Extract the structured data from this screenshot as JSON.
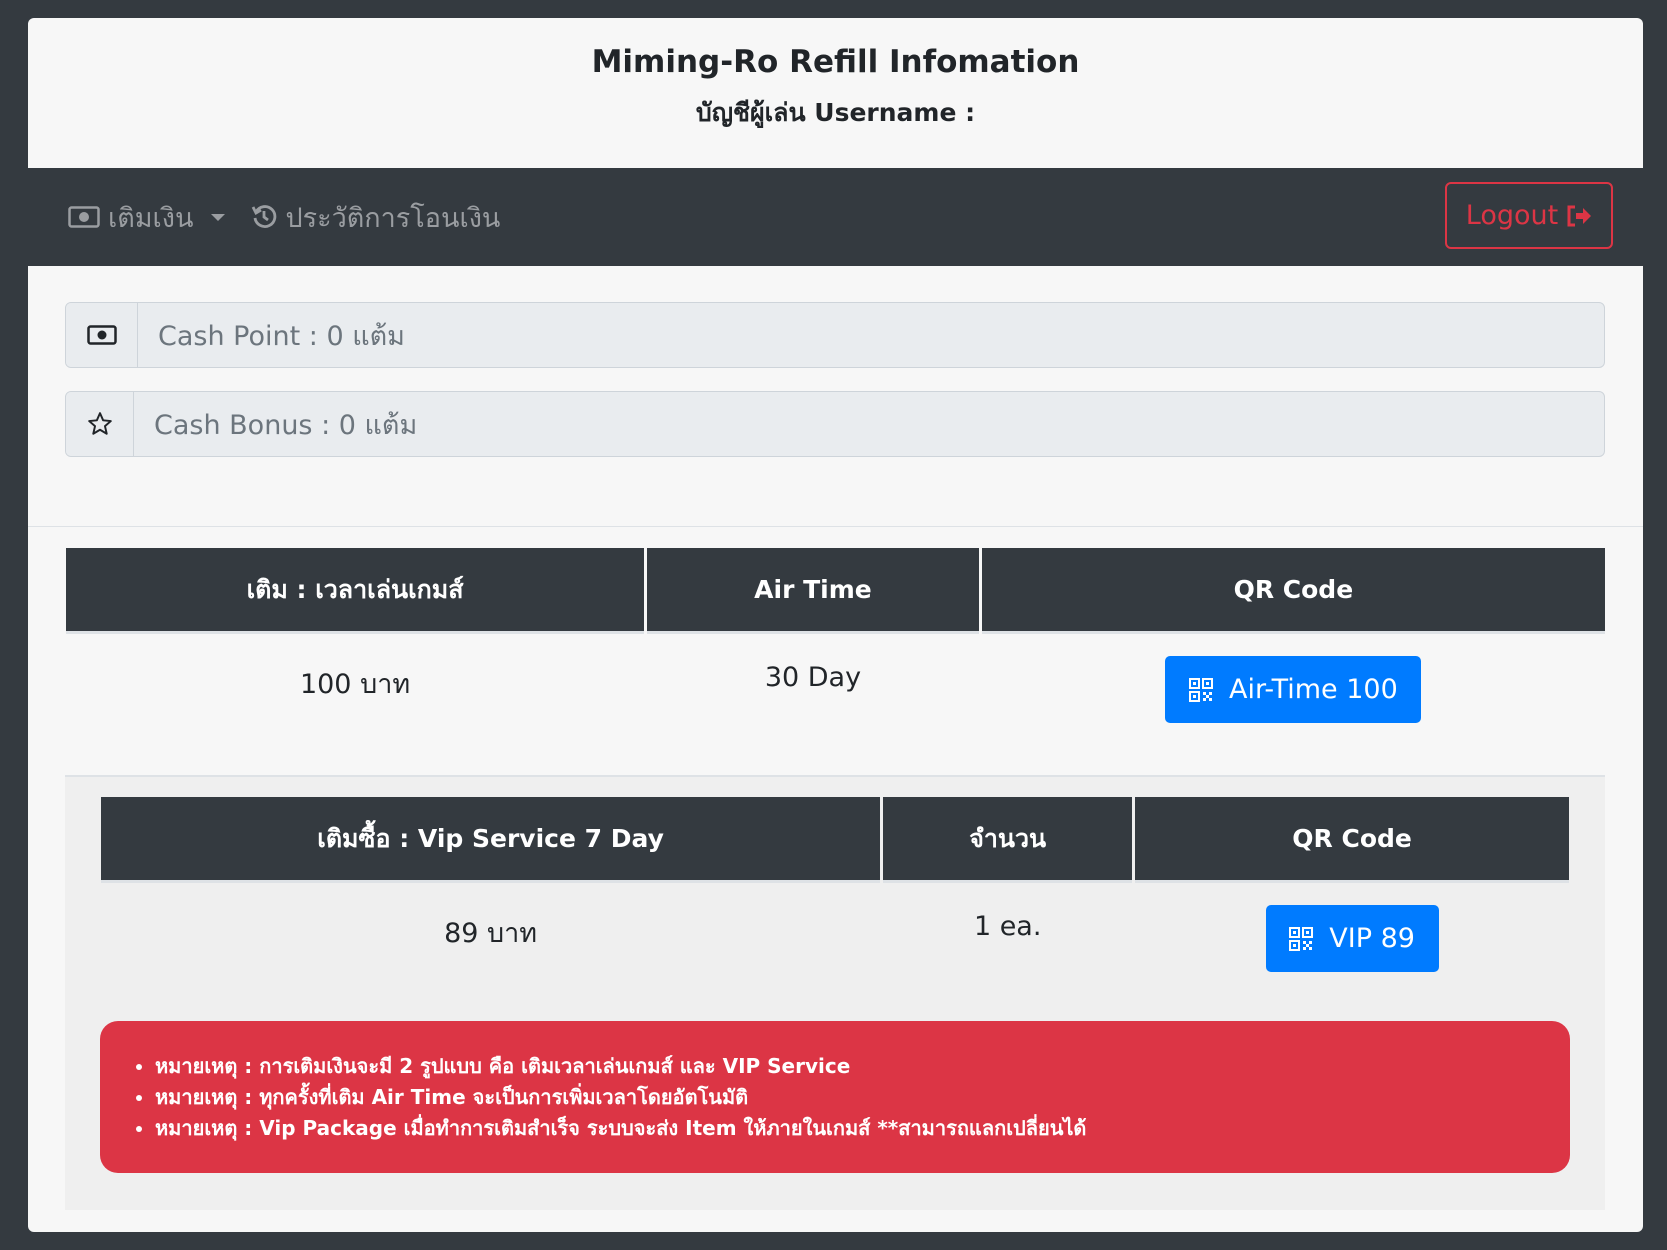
{
  "header": {
    "title": "Miming-Ro Refill Infomation",
    "subtitle": "บัญชีผู้เล่น Username :"
  },
  "navbar": {
    "topup_label": "เติมเงิน",
    "history_label": "ประวัติการโอนเงิน",
    "logout_label": "Logout"
  },
  "balances": {
    "cash_point": "Cash Point : 0 แต้ม",
    "cash_bonus": "Cash Bonus : 0 แต้ม"
  },
  "airtime_table": {
    "headers": [
      "เติม : เวลาเล่นเกมส์",
      "Air Time",
      "QR Code"
    ],
    "row": {
      "price": "100 บาท",
      "duration": "30 Day",
      "button": "Air-Time 100"
    }
  },
  "vip_table": {
    "headers": [
      "เติมซื้อ : Vip Service 7 Day",
      "จำนวน",
      "QR Code"
    ],
    "row": {
      "price": "89 บาท",
      "quantity": "1 ea.",
      "button": "VIP 89"
    }
  },
  "notes": [
    "หมายเหตุ : การเติมเงินจะมี 2 รูปแบบ คือ เติมเวลาเล่นเกมส์ และ VIP Service",
    "หมายเหตุ : ทุกครั้งที่เติม Air Time จะเป็นการเพิ่มเวลาโดยอัตโนมัติ",
    "หมายเหตุ : Vip Package เมื่อทำการเติมสำเร็จ ระบบจะส่ง Item ให้ภายในเกมส์ **สามารถแลกเปลี่ยนได้"
  ],
  "colors": {
    "navbar": "#343a40",
    "primary": "#007bff",
    "danger": "#dc3545"
  },
  "icons": {
    "topup": "money-icon",
    "history": "history-icon",
    "logout": "sign-out-icon",
    "cash_point": "money-icon",
    "cash_bonus": "star-icon",
    "qr": "qrcode-icon"
  }
}
